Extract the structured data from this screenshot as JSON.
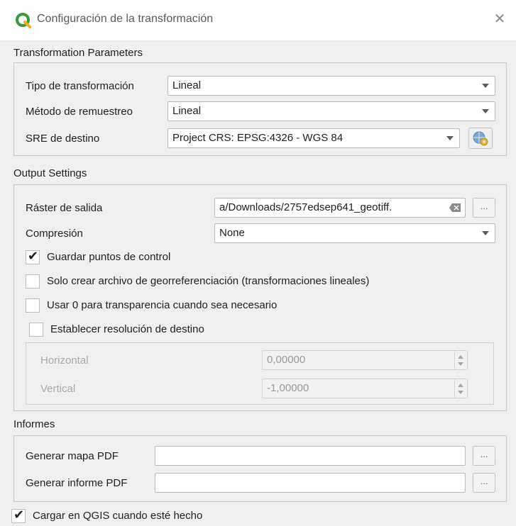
{
  "window": {
    "title": "Configuración de la transformación",
    "close_glyph": "✕",
    "icon": "qgis-logo-icon",
    "accent": "#3a9a3a"
  },
  "transformation": {
    "section_label": "Transformation Parameters",
    "type_label": "Tipo de transformación",
    "type_value": "Lineal",
    "resampling_label": "Método de remuestreo",
    "resampling_value": "Lineal",
    "crs_label": "SRE de destino",
    "crs_value": "Project CRS: EPSG:4326 - WGS 84",
    "crs_button_icon": "globe-gear-icon"
  },
  "output": {
    "section_label": "Output Settings",
    "raster_label": "Ráster de salida",
    "raster_value": "a/Downloads/2757edsep641_geotiff.",
    "raster_browse_label": "...",
    "compression_label": "Compresión",
    "compression_value": "None",
    "checkboxes": [
      {
        "label": "Guardar puntos de control",
        "checked": true
      },
      {
        "label": "Solo crear archivo de georreferenciación (transformaciones lineales)",
        "checked": false
      },
      {
        "label": "Usar 0 para transparencia cuando sea necesario",
        "checked": false
      },
      {
        "label": "Establecer resolución de destino",
        "checked": false
      }
    ],
    "horizontal_label": "Horizontal",
    "horizontal_value": "0,00000",
    "vertical_label": "Vertical",
    "vertical_value": "-1,00000"
  },
  "reports": {
    "section_label": "Informes",
    "pdf_map_label": "Generar mapa PDF",
    "pdf_map_value": "",
    "pdf_map_browse": "...",
    "pdf_report_label": "Generar informe PDF",
    "pdf_report_value": "",
    "pdf_report_browse": "..."
  },
  "footer": {
    "load_label": "Cargar en QGIS cuando esté hecho",
    "load_checked": true,
    "check_glyph": "✔"
  }
}
